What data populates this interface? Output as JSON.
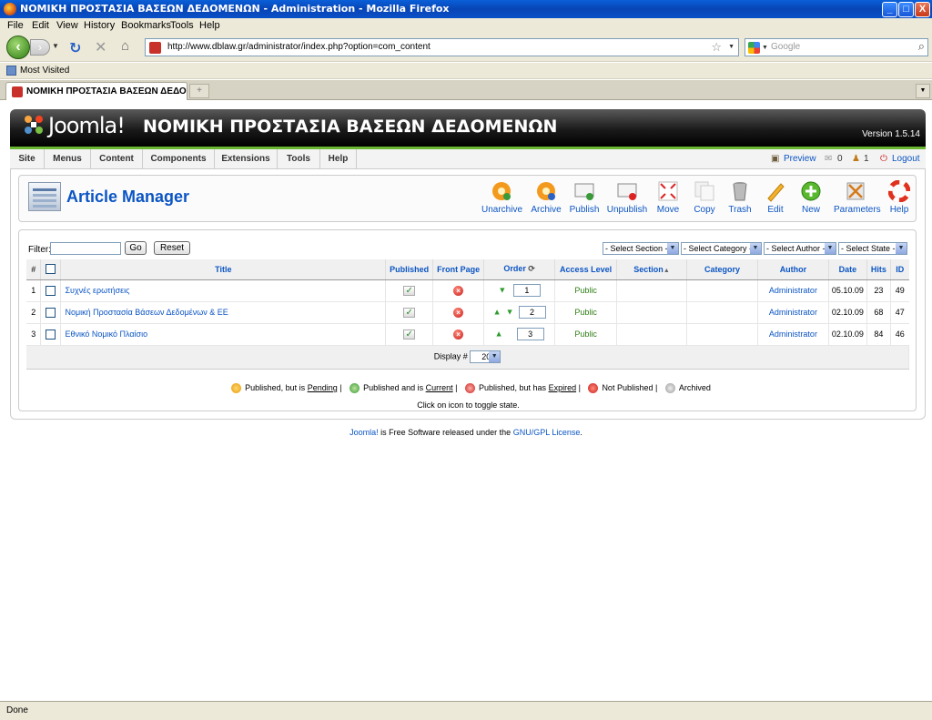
{
  "window": {
    "title": "ΝΟΜΙΚΗ ΠΡΟΣΤΑΣΙΑ ΒΑΣΕΩΝ ΔΕΔΟΜΕΝΩΝ - Administration - Mozilla Firefox",
    "minimize": "_",
    "maximize": "□",
    "close": "X"
  },
  "menubar": [
    "File",
    "Edit",
    "View",
    "History",
    "Bookmarks",
    "Tools",
    "Help"
  ],
  "navbar": {
    "url": "http://www.dblaw.gr/administrator/index.php?option=com_content",
    "search_placeholder": "Google"
  },
  "bookmarks": {
    "most_visited": "Most Visited"
  },
  "tab": {
    "label": "ΝΟΜΙΚΗ ΠΡΟΣΤΑΣΙΑ ΒΑΣΕΩΝ ΔΕΔΟΜ..."
  },
  "joomla": {
    "logo": "Joomla!",
    "site_title": "ΝΟΜΙΚΗ ΠΡΟΣΤΑΣΙΑ ΒΑΣΕΩΝ ΔΕΔΟΜΕΝΩΝ",
    "version": "Version 1.5.14",
    "menu": [
      "Site",
      "Menus",
      "Content",
      "Components",
      "Extensions",
      "Tools",
      "Help"
    ],
    "menu_right": {
      "preview": "Preview",
      "messages": "0",
      "users": "1",
      "logout": "Logout"
    },
    "page_title": "Article Manager",
    "toolbar": [
      "Unarchive",
      "Archive",
      "Publish",
      "Unpublish",
      "Move",
      "Copy",
      "Trash",
      "Edit",
      "New",
      "Parameters",
      "Help"
    ],
    "filter": {
      "label": "Filter:",
      "value": "",
      "go": "Go",
      "reset": "Reset",
      "selects": [
        "- Select Section -",
        "- Select Category -",
        "- Select Author -",
        "- Select State -"
      ]
    },
    "table": {
      "headers": [
        "#",
        "",
        "Title",
        "Published",
        "Front Page",
        "Order",
        "Access Level",
        "Section",
        "Category",
        "Author",
        "Date",
        "Hits",
        "ID"
      ],
      "rows": [
        {
          "num": "1",
          "title": "Συχνές ερωτήσεις",
          "order": "1",
          "access": "Public",
          "section": "",
          "category": "",
          "author": "Administrator",
          "date": "05.10.09",
          "hits": "23",
          "id": "49"
        },
        {
          "num": "2",
          "title": "Νομική Προστασία Βάσεων Δεδομένων & ΕΕ",
          "order": "2",
          "access": "Public",
          "section": "",
          "category": "",
          "author": "Administrator",
          "date": "02.10.09",
          "hits": "68",
          "id": "47"
        },
        {
          "num": "3",
          "title": "Εθνικό Νομικό Πλαίσιο",
          "order": "3",
          "access": "Public",
          "section": "",
          "category": "",
          "author": "Administrator",
          "date": "02.10.09",
          "hits": "84",
          "id": "46"
        }
      ],
      "display_label": "Display #",
      "display_value": "20"
    },
    "legend": {
      "pending_pre": "Published, but is ",
      "pending": "Pending",
      "current_pre": "Published and is ",
      "current": "Current",
      "expired_pre": "Published, but has ",
      "expired": "Expired",
      "not_published": "Not Published",
      "archived": "Archived",
      "sep": " |"
    },
    "toggle_note": "Click on icon to toggle state.",
    "footer": {
      "joomla": "Joomla!",
      "mid": " is Free Software released under the ",
      "license": "GNU/GPL License",
      "end": "."
    }
  },
  "status": "Done",
  "colors": {
    "accent_blue": "#0b55c4",
    "joomla_green": "#69b630",
    "xp_blue": "#0845b6"
  }
}
